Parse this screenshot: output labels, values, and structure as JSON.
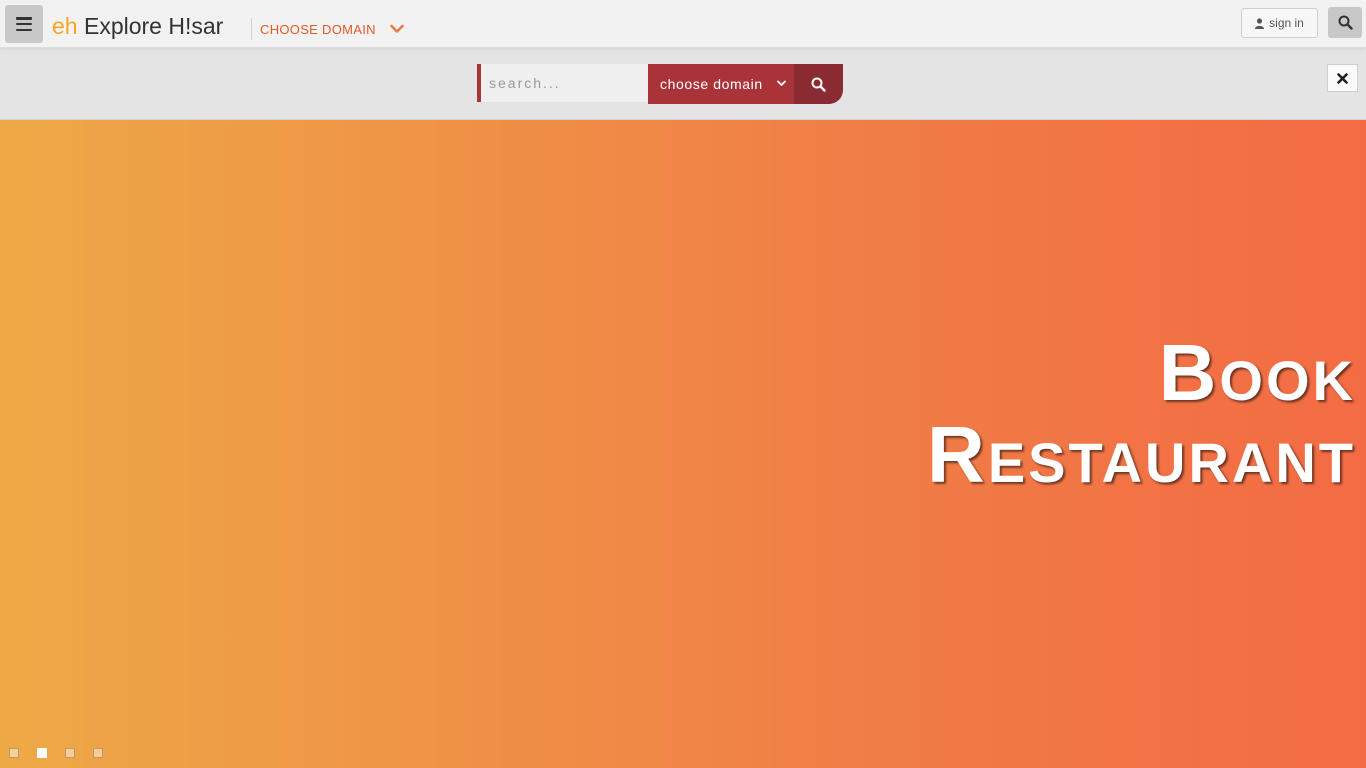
{
  "navbar": {
    "brand_prefix": "eh",
    "brand_name": "Explore H!sar",
    "domain_label": "CHOOSE DOMAIN",
    "signin_label": "sign in",
    "menu_icon": "hamburger-menu-icon",
    "search_icon": "search-icon",
    "user_icon": "user-icon"
  },
  "search_bar": {
    "placeholder": "search...",
    "select_value": "choose domain",
    "submit_icon": "search-icon",
    "close_icon": "close-icon"
  },
  "hero": {
    "title_line1": "Book",
    "title_line2": "Restaurant",
    "slides": [
      {
        "active": false
      },
      {
        "active": true
      },
      {
        "active": false
      },
      {
        "active": false
      }
    ]
  },
  "colors": {
    "accent_orange": "#f5a623",
    "domain_label": "#e05a28",
    "search_red": "#a8343a",
    "search_red_dark": "#8a2a31",
    "hero_gradient_start": "#eea946",
    "hero_gradient_end": "#f36b44"
  }
}
